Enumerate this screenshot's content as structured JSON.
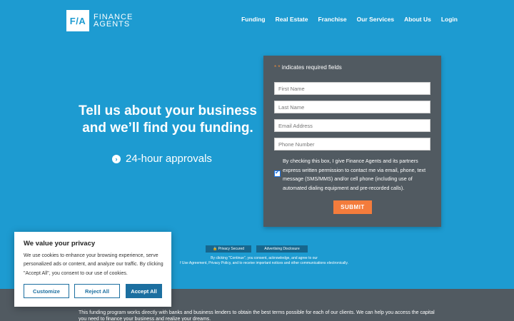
{
  "header": {
    "logo_mark": "F/A",
    "logo_line1": "FINANCE",
    "logo_line2": "AGENTS",
    "nav": [
      "Funding",
      "Real Estate",
      "Franchise",
      "Our Services",
      "About Us",
      "Login"
    ]
  },
  "hero": {
    "headline_line1": "Tell us about your business",
    "headline_line2": "and we’ll find you funding.",
    "approvals": "24-hour approvals"
  },
  "form": {
    "required_star": "* *",
    "required_note": "indicates required fields",
    "first_name_placeholder": "First Name",
    "last_name_placeholder": "Last Name",
    "email_placeholder": "Email Address",
    "phone_placeholder": "Phone Number",
    "consent_checked": true,
    "consent_text": "By checking this box, I give Finance Agents and its partners express written permission to contact me via email, phone, text message (SMS/MMS) and/or cell phone (including use of automated dialing equipment and pre-recorded calls).",
    "submit_label": "SUBMIT"
  },
  "badges": {
    "privacy": "🔒 Privacy Secured",
    "advertising": "Advertising Disclosure"
  },
  "disclaimer": {
    "line1": "By clicking \"Continue\", you consent, acknowledge, and agree to our",
    "line2": "f Use Agreement, Privacy Policy, and to receive important notices and other communications electronically."
  },
  "band": {
    "text": "This funding program works directly with banks and business lenders to obtain the best terms possible for each of our clients. We can help you access the capital you need to finance your business and realize your dreams."
  },
  "cookie": {
    "title": "We value your privacy",
    "body": "We use cookies to enhance your browsing experience, serve personalized ads or content, and analyze our traffic. By clicking \"Accept All\", you consent to our use of cookies.",
    "customize": "Customize",
    "reject": "Reject All",
    "accept": "Accept All"
  },
  "colors": {
    "background": "#1d9bd1",
    "card": "#515a61",
    "submit": "#f47c3c",
    "cookie_button": "#1c6fa0"
  }
}
